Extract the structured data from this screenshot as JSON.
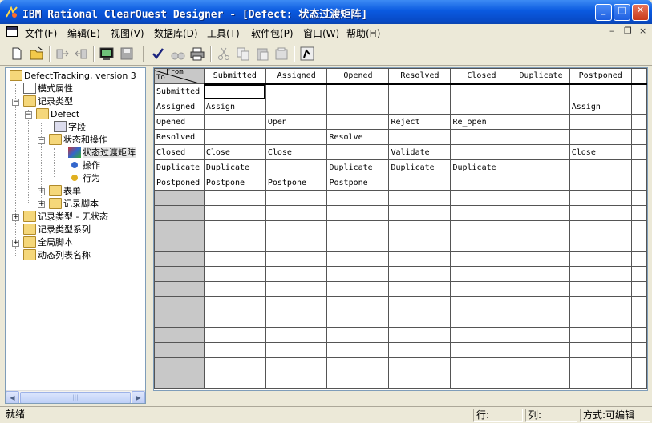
{
  "window": {
    "title": "IBM Rational ClearQuest Designer - [Defect: 状态过渡矩阵]",
    "min_label": "_",
    "max_label": "□",
    "close_label": "✕"
  },
  "menu": {
    "items": [
      "文件(F)",
      "编辑(E)",
      "视图(V)",
      "数据库(D)",
      "工具(T)",
      "软件包(P)",
      "窗口(W)",
      "帮助(H)"
    ],
    "mdi_min": "–",
    "mdi_restore": "❐",
    "mdi_close": "×"
  },
  "tree": {
    "items": [
      {
        "label": "DefectTracking, version 3"
      },
      {
        "label": "模式属性"
      },
      {
        "label": "记录类型"
      },
      {
        "label": "Defect"
      },
      {
        "label": "字段"
      },
      {
        "label": "状态和操作"
      },
      {
        "label": "状态过渡矩阵"
      },
      {
        "label": "操作"
      },
      {
        "label": "行为"
      },
      {
        "label": "表单"
      },
      {
        "label": "记录脚本"
      },
      {
        "label": "记录类型 - 无状态"
      },
      {
        "label": "记录类型系列"
      },
      {
        "label": "全局脚本"
      },
      {
        "label": "动态列表名称"
      }
    ]
  },
  "grid": {
    "corner_from": "From",
    "corner_to": "To",
    "columns": [
      "Submitted",
      "Assigned",
      "Opened",
      "Resolved",
      "Closed",
      "Duplicate",
      "Postponed"
    ],
    "rows": [
      {
        "state": "Submitted",
        "cells": [
          "",
          "",
          "",
          "",
          "",
          "",
          ""
        ]
      },
      {
        "state": "Assigned",
        "cells": [
          "Assign",
          "",
          "",
          "",
          "",
          "",
          "Assign"
        ]
      },
      {
        "state": "Opened",
        "cells": [
          "",
          "Open",
          "",
          "Reject",
          "Re_open",
          "",
          ""
        ]
      },
      {
        "state": "Resolved",
        "cells": [
          "",
          "",
          "Resolve",
          "",
          "",
          "",
          ""
        ]
      },
      {
        "state": "Closed",
        "cells": [
          "Close",
          "Close",
          "",
          "Validate",
          "",
          "",
          "Close"
        ]
      },
      {
        "state": "Duplicate",
        "cells": [
          "Duplicate",
          "",
          "Duplicate",
          "Duplicate",
          "Duplicate",
          "",
          ""
        ]
      },
      {
        "state": "Postponed",
        "cells": [
          "Postpone",
          "Postpone",
          "Postpone",
          "",
          "",
          "",
          ""
        ]
      }
    ],
    "empty_rows": 13
  },
  "status": {
    "ready": "就绪",
    "row_label": "行:",
    "col_label": "列:",
    "mode_label": "方式:可编辑"
  }
}
